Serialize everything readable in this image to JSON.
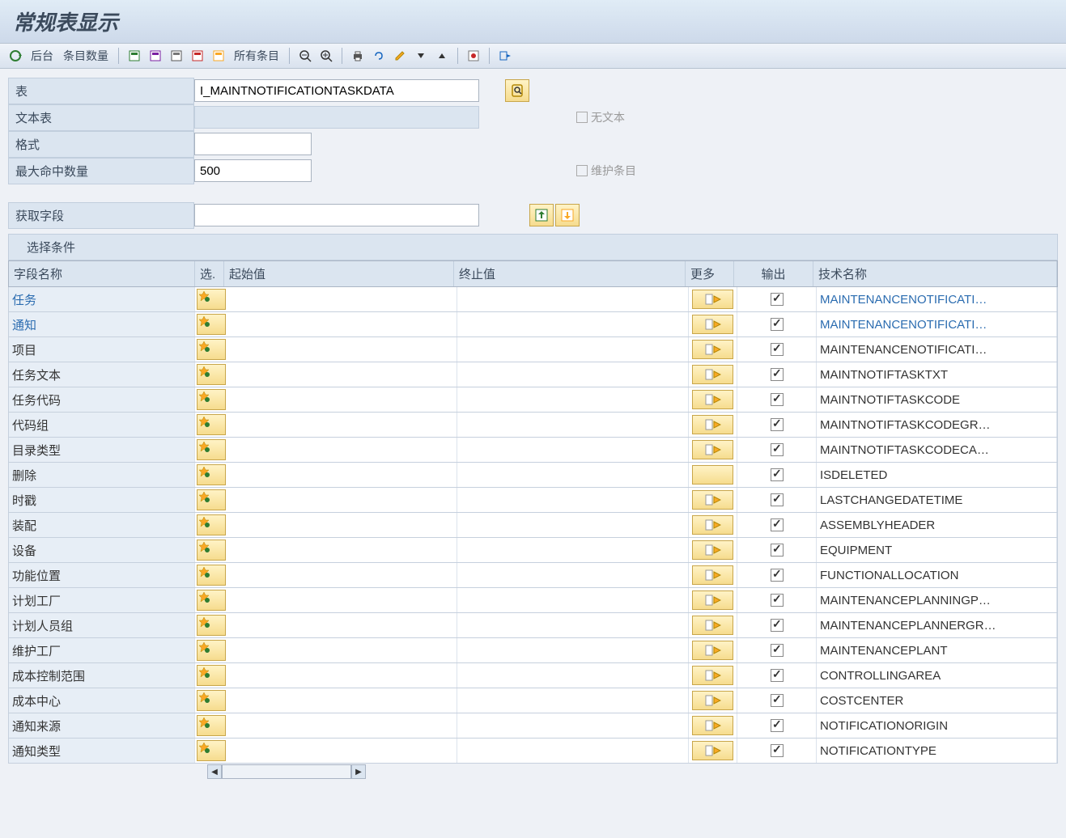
{
  "title": "常规表显示",
  "toolbar": {
    "back_label": "后台",
    "count_label": "条目数量",
    "all_entries_label": "所有条目"
  },
  "form": {
    "table_label": "表",
    "table_value": "I_MAINTNOTIFICATIONTASKDATA",
    "text_table_label": "文本表",
    "no_text_label": "无文本",
    "pattern_label": "格式",
    "pattern_value": "",
    "max_hits_label": "最大命中数量",
    "max_hits_value": "500",
    "maintain_label": "维护条目",
    "fetch_fields_label": "获取字段",
    "fetch_fields_value": "",
    "selection_cond_label": "选择条件"
  },
  "grid": {
    "headers": {
      "field": "字段名称",
      "sel": "选.",
      "start": "起始值",
      "end": "终止值",
      "more": "更多",
      "output": "输出",
      "tech": "技术名称"
    },
    "rows": [
      {
        "field": "任务",
        "link": true,
        "has_more": true,
        "output": true,
        "tech": "MAINTENANCENOTIFICATI…"
      },
      {
        "field": "通知",
        "link": true,
        "has_more": true,
        "output": true,
        "tech": "MAINTENANCENOTIFICATI…"
      },
      {
        "field": "项目",
        "link": false,
        "has_more": true,
        "output": true,
        "tech": "MAINTENANCENOTIFICATI…"
      },
      {
        "field": "任务文本",
        "link": false,
        "has_more": true,
        "output": true,
        "tech": "MAINTNOTIFTASKTXT"
      },
      {
        "field": "任务代码",
        "link": false,
        "has_more": true,
        "output": true,
        "tech": "MAINTNOTIFTASKCODE"
      },
      {
        "field": "代码组",
        "link": false,
        "has_more": true,
        "output": true,
        "tech": "MAINTNOTIFTASKCODEGR…"
      },
      {
        "field": "目录类型",
        "link": false,
        "has_more": true,
        "output": true,
        "tech": "MAINTNOTIFTASKCODECA…"
      },
      {
        "field": "删除",
        "link": false,
        "has_more": false,
        "output": true,
        "tech": "ISDELETED"
      },
      {
        "field": "时戳",
        "link": false,
        "has_more": true,
        "output": true,
        "tech": "LASTCHANGEDATETIME"
      },
      {
        "field": "装配",
        "link": false,
        "has_more": true,
        "output": true,
        "tech": "ASSEMBLYHEADER"
      },
      {
        "field": "设备",
        "link": false,
        "has_more": true,
        "output": true,
        "tech": "EQUIPMENT"
      },
      {
        "field": "功能位置",
        "link": false,
        "has_more": true,
        "output": true,
        "tech": "FUNCTIONALLOCATION"
      },
      {
        "field": "计划工厂",
        "link": false,
        "has_more": true,
        "output": true,
        "tech": "MAINTENANCEPLANNINGP…"
      },
      {
        "field": "计划人员组",
        "link": false,
        "has_more": true,
        "output": true,
        "tech": "MAINTENANCEPLANNERGR…"
      },
      {
        "field": "维护工厂",
        "link": false,
        "has_more": true,
        "output": true,
        "tech": "MAINTENANCEPLANT"
      },
      {
        "field": "成本控制范围",
        "link": false,
        "has_more": true,
        "output": true,
        "tech": "CONTROLLINGAREA"
      },
      {
        "field": "成本中心",
        "link": false,
        "has_more": true,
        "output": true,
        "tech": "COSTCENTER"
      },
      {
        "field": "通知来源",
        "link": false,
        "has_more": true,
        "output": true,
        "tech": "NOTIFICATIONORIGIN"
      },
      {
        "field": "通知类型",
        "link": false,
        "has_more": true,
        "output": true,
        "tech": "NOTIFICATIONTYPE"
      }
    ]
  }
}
